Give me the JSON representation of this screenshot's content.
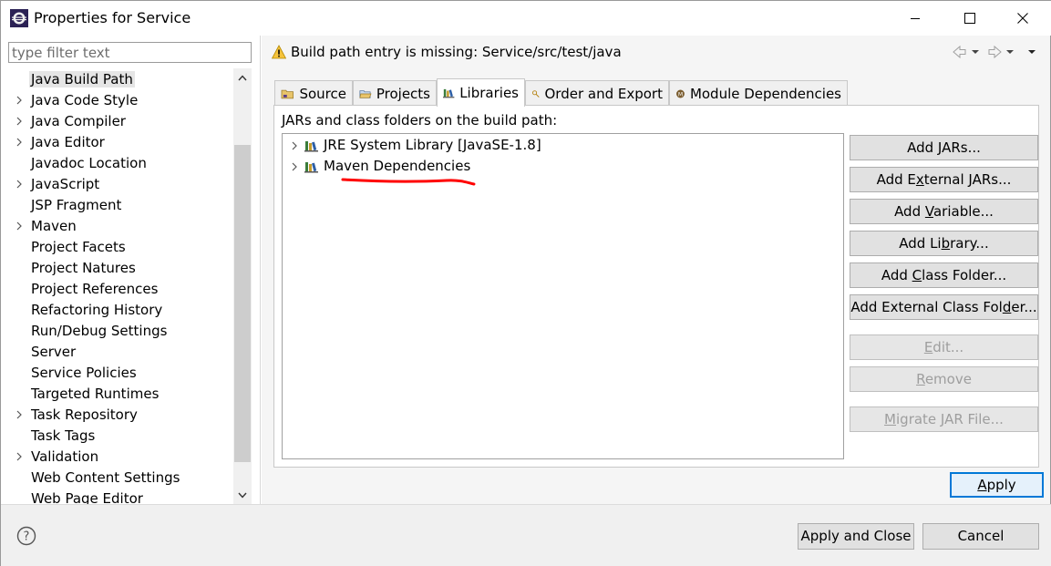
{
  "window": {
    "title": "Properties for Service"
  },
  "filter": {
    "placeholder": "type filter text"
  },
  "sidebar": {
    "items": [
      {
        "label": "Java Build Path",
        "expandable": false,
        "selected": true
      },
      {
        "label": "Java Code Style",
        "expandable": true
      },
      {
        "label": "Java Compiler",
        "expandable": true
      },
      {
        "label": "Java Editor",
        "expandable": true
      },
      {
        "label": "Javadoc Location",
        "expandable": false
      },
      {
        "label": "JavaScript",
        "expandable": true
      },
      {
        "label": "JSP Fragment",
        "expandable": false
      },
      {
        "label": "Maven",
        "expandable": true
      },
      {
        "label": "Project Facets",
        "expandable": false
      },
      {
        "label": "Project Natures",
        "expandable": false
      },
      {
        "label": "Project References",
        "expandable": false
      },
      {
        "label": "Refactoring History",
        "expandable": false
      },
      {
        "label": "Run/Debug Settings",
        "expandable": false
      },
      {
        "label": "Server",
        "expandable": false
      },
      {
        "label": "Service Policies",
        "expandable": false
      },
      {
        "label": "Targeted Runtimes",
        "expandable": false
      },
      {
        "label": "Task Repository",
        "expandable": true
      },
      {
        "label": "Task Tags",
        "expandable": false
      },
      {
        "label": "Validation",
        "expandable": true
      },
      {
        "label": "Web Content Settings",
        "expandable": false
      },
      {
        "label": "Web Page Editor",
        "expandable": false
      }
    ]
  },
  "message": {
    "text": "Build path entry is missing: Service/src/test/java"
  },
  "tabs": [
    {
      "label": "Source",
      "icon": "source-folder-icon"
    },
    {
      "label": "Projects",
      "icon": "projects-icon"
    },
    {
      "label": "Libraries",
      "icon": "libraries-icon",
      "active": true
    },
    {
      "label": "Order and Export",
      "icon": "order-export-icon"
    },
    {
      "label": "Module Dependencies",
      "icon": "module-icon"
    }
  ],
  "libraries": {
    "heading": "JARs and class folders on the build path:",
    "entries": [
      {
        "label": "JRE System Library [JavaSE-1.8]"
      },
      {
        "label": "Maven Dependencies",
        "annotated": true
      }
    ]
  },
  "buttons": {
    "add_jars": {
      "pre": "Add ",
      "key": "J",
      "post": "ARs..."
    },
    "add_external_jars": {
      "pre": "Add E",
      "key": "x",
      "post": "ternal JARs..."
    },
    "add_variable": {
      "pre": "Add ",
      "key": "V",
      "post": "ariable..."
    },
    "add_library": {
      "pre": "Add Li",
      "key": "b",
      "post": "rary..."
    },
    "add_class_folder": {
      "pre": "Add ",
      "key": "C",
      "post": "lass Folder..."
    },
    "add_external_class_folder": {
      "pre": "Add External Class Fol",
      "key": "d",
      "post": "er..."
    },
    "edit": {
      "pre": "",
      "key": "E",
      "post": "dit..."
    },
    "remove": {
      "pre": "",
      "key": "R",
      "post": "emove"
    },
    "migrate_jar": {
      "pre": "",
      "key": "M",
      "post": "igrate JAR File..."
    }
  },
  "apply": {
    "pre": "",
    "key": "A",
    "post": "pply"
  },
  "footer": {
    "apply_and_close": "Apply and Close",
    "cancel": "Cancel"
  },
  "colors": {
    "accent": "#0078d7",
    "annotation": "#ff0000",
    "selection": "#e5e5e5"
  }
}
